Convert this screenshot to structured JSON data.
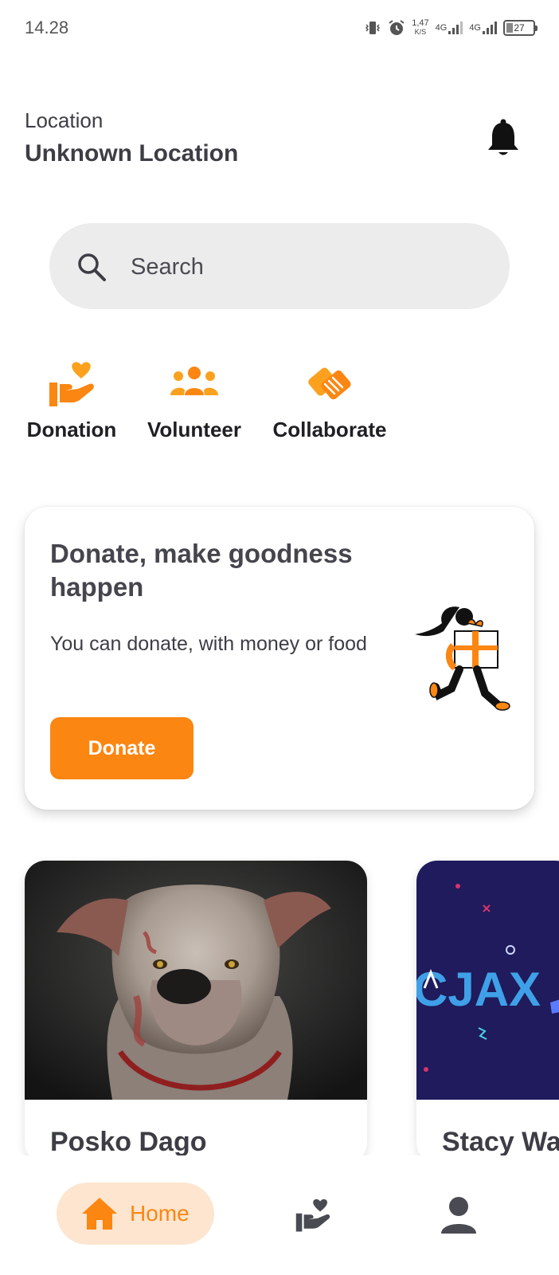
{
  "status_bar": {
    "time": "14.28",
    "net_speed_value": "1,47",
    "net_speed_unit": "K/S",
    "network_1": "4G",
    "network_2": "4G",
    "battery": "27"
  },
  "header": {
    "location_label": "Location",
    "location_value": "Unknown Location"
  },
  "search": {
    "placeholder": "Search"
  },
  "categories": [
    {
      "label": "Donation",
      "icon": "hand-heart-icon"
    },
    {
      "label": "Volunteer",
      "icon": "group-icon"
    },
    {
      "label": "Collaborate",
      "icon": "handshake-icon"
    }
  ],
  "donate_card": {
    "title": "Donate, make goodness happen",
    "subtitle": "You can donate, with money or food",
    "button_label": "Donate"
  },
  "campaigns": [
    {
      "name": "Posko Dago"
    },
    {
      "name": "Stacy Wa"
    }
  ],
  "bottom_nav": {
    "home_label": "Home"
  },
  "colors": {
    "accent": "#fb8611",
    "accent_light": "#fde5cf",
    "text": "#3d3d45",
    "search_bg": "#ececec"
  }
}
